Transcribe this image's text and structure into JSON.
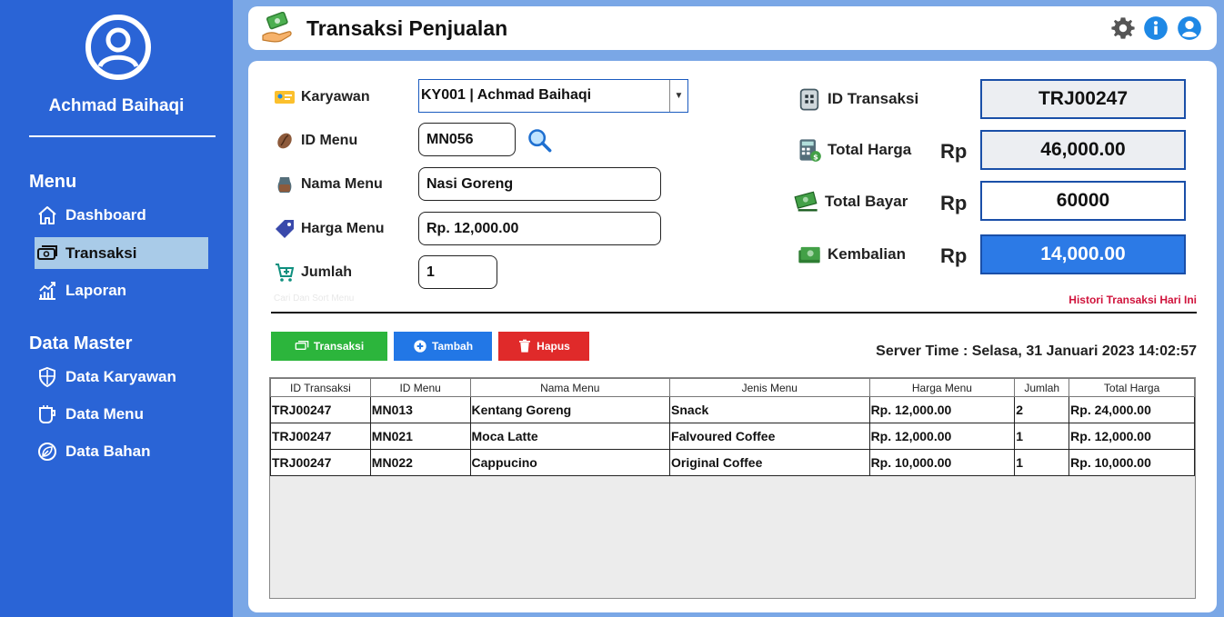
{
  "sidebar": {
    "user_name": "Achmad Baihaqi",
    "menu_title": "Menu",
    "menu_items": [
      {
        "label": "Dashboard",
        "icon": "home-icon"
      },
      {
        "label": "Transaksi",
        "icon": "money-icon",
        "active": true
      },
      {
        "label": "Laporan",
        "icon": "chart-icon"
      }
    ],
    "master_title": "Data Master",
    "master_items": [
      {
        "label": "Data Karyawan",
        "icon": "shield-icon"
      },
      {
        "label": "Data Menu",
        "icon": "cup-icon"
      },
      {
        "label": "Data Bahan",
        "icon": "leaf-icon"
      }
    ]
  },
  "header": {
    "title": "Transaksi Penjualan"
  },
  "form": {
    "karyawan_label": "Karyawan",
    "karyawan_value": "KY001 | Achmad Baihaqi",
    "id_menu_label": "ID Menu",
    "id_menu_value": "MN056",
    "nama_menu_label": "Nama Menu",
    "nama_menu_value": "Nasi Goreng",
    "harga_menu_label": "Harga Menu",
    "harga_menu_value": "Rp. 12,000.00",
    "jumlah_label": "Jumlah",
    "jumlah_value": "1",
    "hint": "Cari Dan Sort Menu"
  },
  "summary": {
    "id_transaksi_label": "ID Transaksi",
    "id_transaksi_value": "TRJ00247",
    "total_harga_label": "Total Harga",
    "total_harga_value": "46,000.00",
    "total_bayar_label": "Total Bayar",
    "total_bayar_value": "60000",
    "kembalian_label": "Kembalian",
    "kembalian_value": "14,000.00",
    "currency": "Rp"
  },
  "actions": {
    "history_link": "Histori Transaksi Hari Ini",
    "transaksi_label": "Transaksi",
    "tambah_label": "Tambah",
    "hapus_label": "Hapus",
    "server_time": "Server Time : Selasa, 31 Januari 2023 14:02:57"
  },
  "colors": {
    "sidebar": "#2a64d6",
    "btn_transaksi": "#2cb53c",
    "btn_tambah": "#2277e6",
    "btn_hapus": "#e02a2a",
    "kembalian_bg": "#2c7ae6",
    "readonly_bg": "#eceef2"
  },
  "table": {
    "columns": [
      "ID Transaksi",
      "ID Menu",
      "Nama Menu",
      "Jenis Menu",
      "Harga Menu",
      "Jumlah",
      "Total Harga"
    ],
    "rows": [
      [
        "TRJ00247",
        "MN013",
        "Kentang Goreng",
        "Snack",
        "Rp. 12,000.00",
        "2",
        "Rp. 24,000.00"
      ],
      [
        "TRJ00247",
        "MN021",
        "Moca Latte",
        "Falvoured Coffee",
        "Rp. 12,000.00",
        "1",
        "Rp. 12,000.00"
      ],
      [
        "TRJ00247",
        "MN022",
        "Cappucino",
        "Original Coffee",
        "Rp. 10,000.00",
        "1",
        "Rp. 10,000.00"
      ]
    ]
  }
}
